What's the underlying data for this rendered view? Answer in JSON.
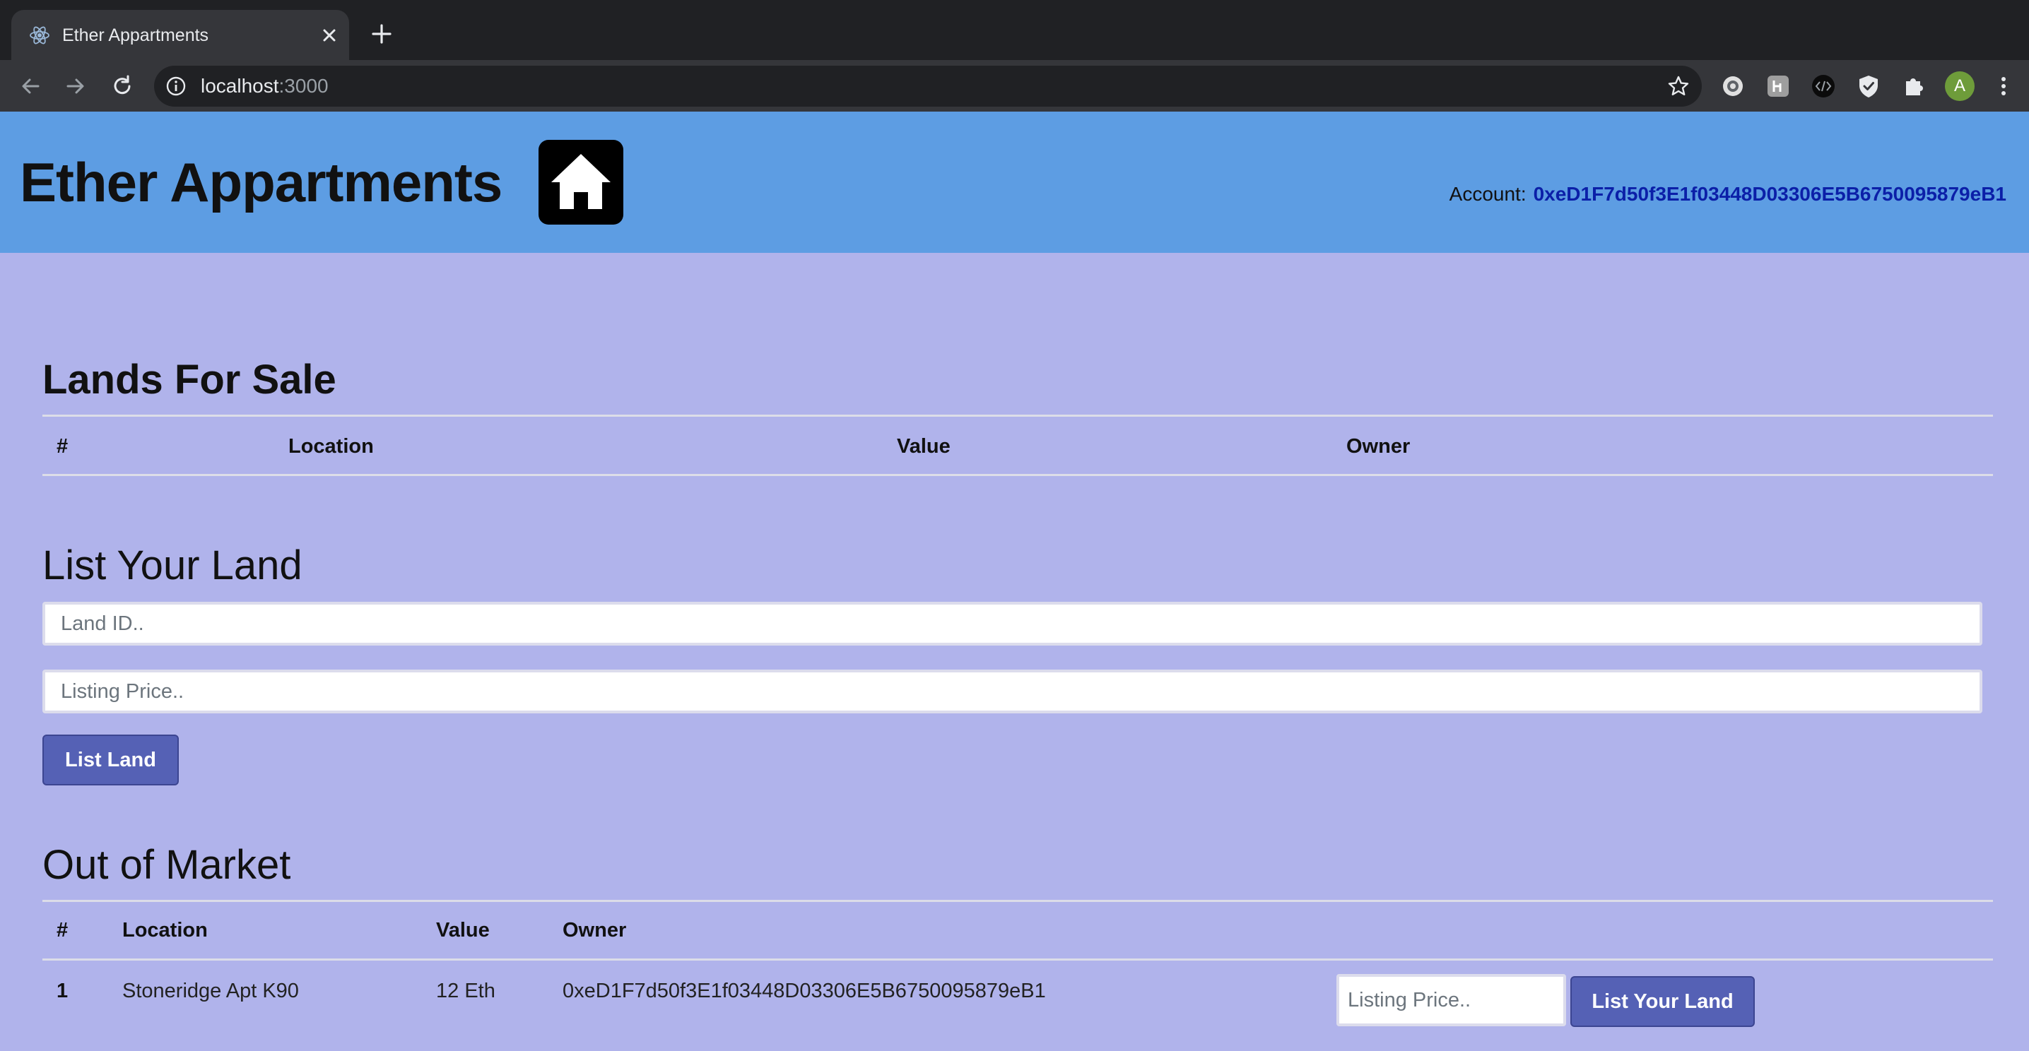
{
  "browser": {
    "tab_title": "Ether Appartments",
    "url_host": "localhost",
    "url_port": ":3000",
    "profile_initial": "A"
  },
  "header": {
    "title": "Ether Appartments",
    "logo_icon": "home-icon",
    "account_label": "Account:",
    "account_address": "0xeD1F7d50f3E1f03448D03306E5B6750095879eB1"
  },
  "lands_for_sale": {
    "title": "Lands For Sale",
    "columns": [
      "#",
      "Location",
      "Value",
      "Owner"
    ],
    "rows": []
  },
  "list_your_land": {
    "title": "List Your Land",
    "land_id_placeholder": "Land ID..",
    "listing_price_placeholder": "Listing Price..",
    "submit_label": "List Land"
  },
  "out_of_market": {
    "title": "Out of Market",
    "columns": [
      "#",
      "Location",
      "Value",
      "Owner"
    ],
    "rows": [
      {
        "id": "1",
        "location": "Stoneridge Apt K90",
        "value": "12 Eth",
        "owner": "0xeD1F7d50f3E1f03448D03306E5B6750095879eB1",
        "price_placeholder": "Listing Price..",
        "action_label": "List Your Land"
      }
    ]
  },
  "colors": {
    "header_bg": "#5d9de3",
    "page_bg": "#b0b3eb",
    "button_bg": "#5561b5",
    "account_address": "#0b1fa8"
  }
}
